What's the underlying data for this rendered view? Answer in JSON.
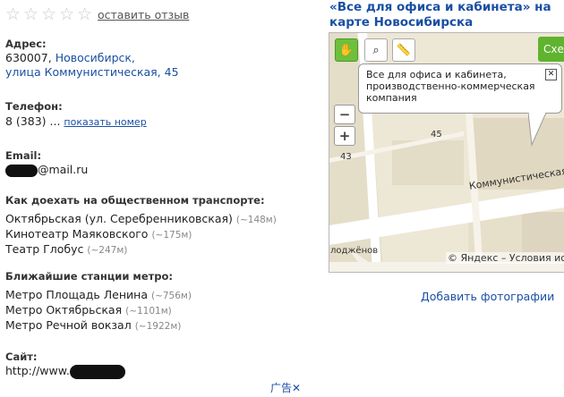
{
  "rating": {
    "review_link": "оставить отзыв"
  },
  "address": {
    "label": "Адрес:",
    "postcode": "630007,",
    "city": "Новосибирск,",
    "street": "улица Коммунистическая, 45"
  },
  "phone": {
    "label": "Телефон:",
    "number": "8 (383) ...",
    "show_link": "показать номер"
  },
  "email": {
    "label": "Email:",
    "suffix": "@mail.ru"
  },
  "transport": {
    "label": "Как доехать на общественном транспорте:",
    "stops": [
      {
        "name": "Октябрьская (ул. Серебренниковская)",
        "dist": "(~148м)"
      },
      {
        "name": "Кинотеатр Маяковского",
        "dist": "(~175м)"
      },
      {
        "name": "Театр Глобус",
        "dist": "(~247м)"
      }
    ]
  },
  "metro": {
    "label": "Ближайшие станции метро:",
    "stations": [
      {
        "name": "Метро Площадь Ленина",
        "dist": "(~756м)"
      },
      {
        "name": "Метро Октябрьская",
        "dist": "(~1101м)"
      },
      {
        "name": "Метро Речной вокзал",
        "dist": "(~1922м)"
      }
    ]
  },
  "site": {
    "label": "Сайт:",
    "prefix": "http://www."
  },
  "ad": {
    "text": "广告✕"
  },
  "title": "«Все для офиса и кабинета» на карте Новосибирска",
  "map": {
    "button": "Схе",
    "balloon_line1": "Все для офиса и кабинета,",
    "balloon_line2": "производственно-коммерческая",
    "balloon_line3": "компания",
    "label_45": "45",
    "label_43": "43",
    "street": "Коммунистическая",
    "street_left": "лоджёнов",
    "copyright": "© Яндекс – Условия ис"
  },
  "add_photo": "Добавить фотографии",
  "colors": {
    "link": "#1a4fa3",
    "accent_green": "#6fbf3c"
  }
}
